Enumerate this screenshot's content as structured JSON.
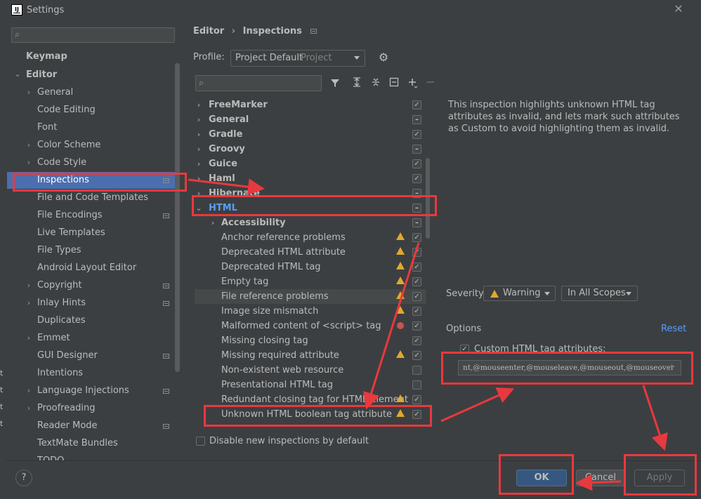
{
  "window": {
    "title": "Settings"
  },
  "sidebar": {
    "search_placeholder": "",
    "items": [
      {
        "label": "Keymap"
      },
      {
        "label": "Editor"
      },
      {
        "label": "General"
      },
      {
        "label": "Code Editing"
      },
      {
        "label": "Font"
      },
      {
        "label": "Color Scheme"
      },
      {
        "label": "Code Style"
      },
      {
        "label": "Inspections"
      },
      {
        "label": "File and Code Templates"
      },
      {
        "label": "File Encodings"
      },
      {
        "label": "Live Templates"
      },
      {
        "label": "File Types"
      },
      {
        "label": "Android Layout Editor"
      },
      {
        "label": "Copyright"
      },
      {
        "label": "Inlay Hints"
      },
      {
        "label": "Duplicates"
      },
      {
        "label": "Emmet"
      },
      {
        "label": "GUI Designer"
      },
      {
        "label": "Intentions"
      },
      {
        "label": "Language Injections"
      },
      {
        "label": "Proofreading"
      },
      {
        "label": "Reader Mode"
      },
      {
        "label": "TextMate Bundles"
      },
      {
        "label": "TODO"
      }
    ]
  },
  "breadcrumb": {
    "parent": "Editor",
    "separator": "›",
    "current": "Inspections"
  },
  "profile": {
    "label": "Profile:",
    "value": "Project Default",
    "scope": "Project"
  },
  "inspections": [
    {
      "label": "FreeMarker",
      "check": "✓"
    },
    {
      "label": "General",
      "check": "–"
    },
    {
      "label": "Gradle",
      "check": "✓"
    },
    {
      "label": "Groovy",
      "check": "–"
    },
    {
      "label": "Guice",
      "check": "✓"
    },
    {
      "label": "Haml",
      "check": "✓"
    },
    {
      "label": "Hibernate",
      "check": "–"
    },
    {
      "label": "HTML",
      "check": "–"
    },
    {
      "label": "Accessibility",
      "check": "–"
    },
    {
      "label": "Anchor reference problems",
      "check": "✓"
    },
    {
      "label": "Deprecated HTML attribute",
      "check": "✓"
    },
    {
      "label": "Deprecated HTML tag",
      "check": "✓"
    },
    {
      "label": "Empty tag",
      "check": "✓"
    },
    {
      "label": "File reference problems",
      "check": "✓"
    },
    {
      "label": "Image size mismatch",
      "check": "✓"
    },
    {
      "label": "Malformed content of <script> tag",
      "check": "✓"
    },
    {
      "label": "Missing closing tag",
      "check": "✓"
    },
    {
      "label": "Missing required attribute",
      "check": "✓"
    },
    {
      "label": "Non-existent web resource",
      "check": ""
    },
    {
      "label": "Presentational HTML tag",
      "check": ""
    },
    {
      "label": "Redundant closing tag for HTML element",
      "check": "✓"
    },
    {
      "label": "Unknown HTML boolean tag attribute",
      "check": "✓"
    }
  ],
  "description": "This inspection highlights unknown HTML tag attributes as invalid, and lets mark such attributes as Custom to avoid highlighting them as invalid.",
  "severity": {
    "label": "Severity:",
    "value": "Warning",
    "scope": "In All Scopes"
  },
  "options": {
    "label": "Options",
    "reset": "Reset",
    "custom_label": "Custom HTML tag attributes:",
    "custom_check": "✓",
    "custom_value": "nt,@mouseenter,@mouseleave,@mouseout,@mouseover"
  },
  "disable_new": "Disable new inspections by default",
  "buttons": {
    "help": "?",
    "ok": "OK",
    "cancel": "Cancel",
    "apply": "Apply"
  },
  "icons": {
    "close": "✕",
    "gear": "⚙",
    "search": "⌕",
    "filter": "⏷",
    "expand": "⤢"
  },
  "colors": {
    "selection": "#4b6eaf",
    "link": "#589df6",
    "warning": "#e0a82e",
    "error": "#c75450",
    "annotation": "#e8393e"
  }
}
